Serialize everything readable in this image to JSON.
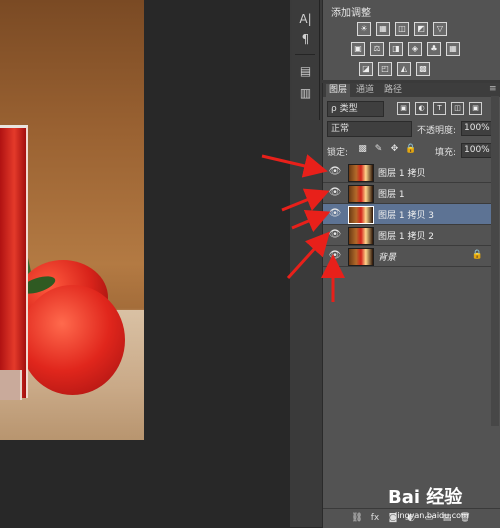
{
  "toolbar": {
    "items": [
      {
        "icon": "character-A-icon",
        "glyph": "A|"
      },
      {
        "icon": "paragraph-icon",
        "glyph": "¶"
      },
      {
        "icon": "history-icon",
        "glyph": "▤"
      },
      {
        "icon": "notes-icon",
        "glyph": "▥"
      }
    ]
  },
  "adjustments": {
    "title": "添加调整",
    "row1": [
      "☀",
      "▦",
      "◫",
      "◩",
      "▽"
    ],
    "row2": [
      "▣",
      "⚖",
      "◨",
      "◈",
      "♣",
      "▦"
    ],
    "row3": [
      "◪",
      "◰",
      "◭",
      "▩"
    ]
  },
  "layers": {
    "tabs": [
      "图层",
      "通道",
      "路径"
    ],
    "active_tab": 0,
    "filter": {
      "label": "ρ 类型",
      "icons": [
        "▣",
        "◐",
        "T",
        "◫",
        "▣"
      ]
    },
    "blend_mode": "正常",
    "opacity_label": "不透明度:",
    "opacity_value": "100%",
    "lock_label": "锁定:",
    "lock_icons": [
      "▩",
      "✎",
      "✥",
      "🔒"
    ],
    "fill_label": "填充:",
    "fill_value": "100%",
    "items": [
      {
        "name": "图层 1 拷贝",
        "visible": true,
        "selected": false,
        "italic": false
      },
      {
        "name": "图层 1",
        "visible": true,
        "selected": false,
        "italic": false
      },
      {
        "name": "图层 1 拷贝 3",
        "visible": true,
        "selected": true,
        "italic": false
      },
      {
        "name": "图层 1 拷贝 2",
        "visible": true,
        "selected": false,
        "italic": false
      },
      {
        "name": "背景",
        "visible": true,
        "selected": false,
        "italic": true,
        "locked": true
      }
    ],
    "footer_icons": [
      "⛓",
      "fx",
      "◙",
      "◐",
      "▭",
      "▤",
      "🗑"
    ]
  },
  "watermark": {
    "text": "Bai 经验",
    "sub": "jingyan.baidu.com"
  }
}
